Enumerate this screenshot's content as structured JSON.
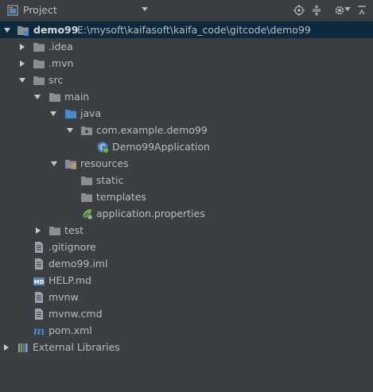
{
  "header": {
    "title": "Project",
    "icons": [
      "project-view-icon",
      "dropdown-icon",
      "locate-icon",
      "collapse-all-icon",
      "settings-icon",
      "hide-icon"
    ]
  },
  "tree": [
    {
      "label": "demo99",
      "path": "E:\\mysoft\\kaifasoft\\kaifa_code\\gitcode\\demo99",
      "icon": "module-folder",
      "expanded": true
    },
    {
      "label": ".idea",
      "icon": "folder",
      "expanded": false
    },
    {
      "label": ".mvn",
      "icon": "folder",
      "expanded": false
    },
    {
      "label": "src",
      "icon": "folder",
      "expanded": true
    },
    {
      "label": "main",
      "icon": "folder",
      "expanded": true
    },
    {
      "label": "java",
      "icon": "source-folder",
      "expanded": true
    },
    {
      "label": "com.example.demo99",
      "icon": "package",
      "expanded": true
    },
    {
      "label": "Demo99Application",
      "icon": "spring-class"
    },
    {
      "label": "resources",
      "icon": "resources-folder",
      "expanded": true
    },
    {
      "label": "static",
      "icon": "folder"
    },
    {
      "label": "templates",
      "icon": "folder"
    },
    {
      "label": "application.properties",
      "icon": "spring-properties"
    },
    {
      "label": "test",
      "icon": "folder",
      "expanded": false
    },
    {
      "label": ".gitignore",
      "icon": "text-file"
    },
    {
      "label": "demo99.iml",
      "icon": "text-file"
    },
    {
      "label": "HELP.md",
      "icon": "markdown-file"
    },
    {
      "label": "mvnw",
      "icon": "text-file"
    },
    {
      "label": "mvnw.cmd",
      "icon": "text-file"
    },
    {
      "label": "pom.xml",
      "icon": "maven-file"
    },
    {
      "label": "External Libraries",
      "icon": "libraries",
      "expanded": false
    }
  ],
  "colors": {
    "background": "#3c3f41",
    "selection": "#0d293e",
    "text": "#bbbbbb",
    "folder": "#8a8e92",
    "source_folder": "#4a88c7",
    "spring_green": "#6db33f"
  }
}
